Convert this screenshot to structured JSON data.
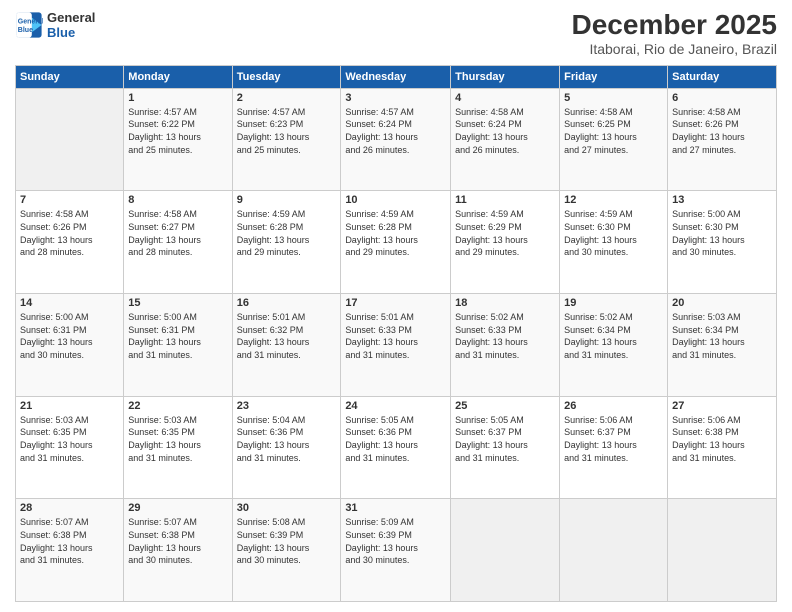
{
  "logo": {
    "line1": "General",
    "line2": "Blue"
  },
  "title": "December 2025",
  "subtitle": "Itaborai, Rio de Janeiro, Brazil",
  "days_of_week": [
    "Sunday",
    "Monday",
    "Tuesday",
    "Wednesday",
    "Thursday",
    "Friday",
    "Saturday"
  ],
  "weeks": [
    [
      {
        "day": "",
        "info": ""
      },
      {
        "day": "1",
        "info": "Sunrise: 4:57 AM\nSunset: 6:22 PM\nDaylight: 13 hours\nand 25 minutes."
      },
      {
        "day": "2",
        "info": "Sunrise: 4:57 AM\nSunset: 6:23 PM\nDaylight: 13 hours\nand 25 minutes."
      },
      {
        "day": "3",
        "info": "Sunrise: 4:57 AM\nSunset: 6:24 PM\nDaylight: 13 hours\nand 26 minutes."
      },
      {
        "day": "4",
        "info": "Sunrise: 4:58 AM\nSunset: 6:24 PM\nDaylight: 13 hours\nand 26 minutes."
      },
      {
        "day": "5",
        "info": "Sunrise: 4:58 AM\nSunset: 6:25 PM\nDaylight: 13 hours\nand 27 minutes."
      },
      {
        "day": "6",
        "info": "Sunrise: 4:58 AM\nSunset: 6:26 PM\nDaylight: 13 hours\nand 27 minutes."
      }
    ],
    [
      {
        "day": "7",
        "info": "Sunrise: 4:58 AM\nSunset: 6:26 PM\nDaylight: 13 hours\nand 28 minutes."
      },
      {
        "day": "8",
        "info": "Sunrise: 4:58 AM\nSunset: 6:27 PM\nDaylight: 13 hours\nand 28 minutes."
      },
      {
        "day": "9",
        "info": "Sunrise: 4:59 AM\nSunset: 6:28 PM\nDaylight: 13 hours\nand 29 minutes."
      },
      {
        "day": "10",
        "info": "Sunrise: 4:59 AM\nSunset: 6:28 PM\nDaylight: 13 hours\nand 29 minutes."
      },
      {
        "day": "11",
        "info": "Sunrise: 4:59 AM\nSunset: 6:29 PM\nDaylight: 13 hours\nand 29 minutes."
      },
      {
        "day": "12",
        "info": "Sunrise: 4:59 AM\nSunset: 6:30 PM\nDaylight: 13 hours\nand 30 minutes."
      },
      {
        "day": "13",
        "info": "Sunrise: 5:00 AM\nSunset: 6:30 PM\nDaylight: 13 hours\nand 30 minutes."
      }
    ],
    [
      {
        "day": "14",
        "info": "Sunrise: 5:00 AM\nSunset: 6:31 PM\nDaylight: 13 hours\nand 30 minutes."
      },
      {
        "day": "15",
        "info": "Sunrise: 5:00 AM\nSunset: 6:31 PM\nDaylight: 13 hours\nand 31 minutes."
      },
      {
        "day": "16",
        "info": "Sunrise: 5:01 AM\nSunset: 6:32 PM\nDaylight: 13 hours\nand 31 minutes."
      },
      {
        "day": "17",
        "info": "Sunrise: 5:01 AM\nSunset: 6:33 PM\nDaylight: 13 hours\nand 31 minutes."
      },
      {
        "day": "18",
        "info": "Sunrise: 5:02 AM\nSunset: 6:33 PM\nDaylight: 13 hours\nand 31 minutes."
      },
      {
        "day": "19",
        "info": "Sunrise: 5:02 AM\nSunset: 6:34 PM\nDaylight: 13 hours\nand 31 minutes."
      },
      {
        "day": "20",
        "info": "Sunrise: 5:03 AM\nSunset: 6:34 PM\nDaylight: 13 hours\nand 31 minutes."
      }
    ],
    [
      {
        "day": "21",
        "info": "Sunrise: 5:03 AM\nSunset: 6:35 PM\nDaylight: 13 hours\nand 31 minutes."
      },
      {
        "day": "22",
        "info": "Sunrise: 5:03 AM\nSunset: 6:35 PM\nDaylight: 13 hours\nand 31 minutes."
      },
      {
        "day": "23",
        "info": "Sunrise: 5:04 AM\nSunset: 6:36 PM\nDaylight: 13 hours\nand 31 minutes."
      },
      {
        "day": "24",
        "info": "Sunrise: 5:05 AM\nSunset: 6:36 PM\nDaylight: 13 hours\nand 31 minutes."
      },
      {
        "day": "25",
        "info": "Sunrise: 5:05 AM\nSunset: 6:37 PM\nDaylight: 13 hours\nand 31 minutes."
      },
      {
        "day": "26",
        "info": "Sunrise: 5:06 AM\nSunset: 6:37 PM\nDaylight: 13 hours\nand 31 minutes."
      },
      {
        "day": "27",
        "info": "Sunrise: 5:06 AM\nSunset: 6:38 PM\nDaylight: 13 hours\nand 31 minutes."
      }
    ],
    [
      {
        "day": "28",
        "info": "Sunrise: 5:07 AM\nSunset: 6:38 PM\nDaylight: 13 hours\nand 31 minutes."
      },
      {
        "day": "29",
        "info": "Sunrise: 5:07 AM\nSunset: 6:38 PM\nDaylight: 13 hours\nand 30 minutes."
      },
      {
        "day": "30",
        "info": "Sunrise: 5:08 AM\nSunset: 6:39 PM\nDaylight: 13 hours\nand 30 minutes."
      },
      {
        "day": "31",
        "info": "Sunrise: 5:09 AM\nSunset: 6:39 PM\nDaylight: 13 hours\nand 30 minutes."
      },
      {
        "day": "",
        "info": ""
      },
      {
        "day": "",
        "info": ""
      },
      {
        "day": "",
        "info": ""
      }
    ]
  ]
}
